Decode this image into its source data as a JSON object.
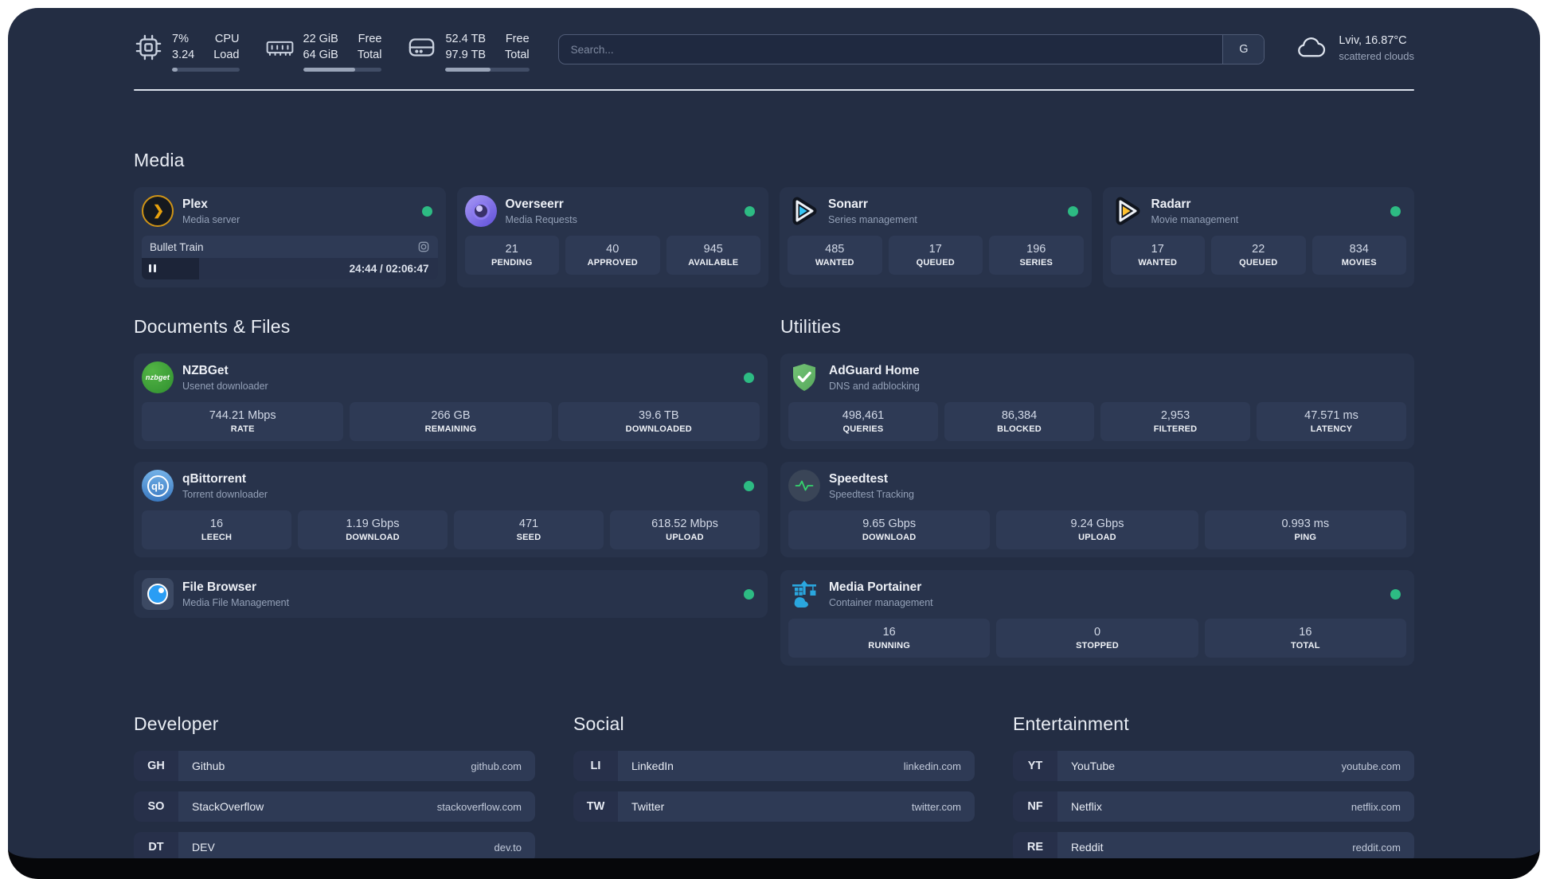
{
  "topbar": {
    "resources": [
      {
        "icon": "cpu-icon",
        "values": [
          "7%",
          "3.24"
        ],
        "labels": [
          "CPU",
          "Load"
        ],
        "progress_pct": 8
      },
      {
        "icon": "ram-icon",
        "values": [
          "22 GiB",
          "64 GiB"
        ],
        "labels": [
          "Free",
          "Total"
        ],
        "progress_pct": 66
      },
      {
        "icon": "disk-icon",
        "values": [
          "52.4 TB",
          "97.9 TB"
        ],
        "labels": [
          "Free",
          "Total"
        ],
        "progress_pct": 54
      }
    ],
    "search": {
      "placeholder": "Search...",
      "provider_initial": "G"
    },
    "weather": {
      "location_temp": "Lviv, 16.87°C",
      "condition": "scattered clouds"
    }
  },
  "sections": {
    "media": {
      "title": "Media",
      "cards": [
        {
          "name": "Plex",
          "subtitle": "Media server",
          "icon": "plex-icon",
          "online": true,
          "player": {
            "title": "Bullet Train",
            "time": "24:44 / 02:06:47",
            "progress_pct": 19.5
          }
        },
        {
          "name": "Overseerr",
          "subtitle": "Media Requests",
          "icon": "overseerr-icon",
          "online": true,
          "stats": [
            {
              "value": "21",
              "label": "PENDING"
            },
            {
              "value": "40",
              "label": "APPROVED"
            },
            {
              "value": "945",
              "label": "AVAILABLE"
            }
          ]
        },
        {
          "name": "Sonarr",
          "subtitle": "Series management",
          "icon": "sonarr-icon",
          "icon_color": "#35c5f4",
          "online": true,
          "stats": [
            {
              "value": "485",
              "label": "WANTED"
            },
            {
              "value": "17",
              "label": "QUEUED"
            },
            {
              "value": "196",
              "label": "SERIES"
            }
          ]
        },
        {
          "name": "Radarr",
          "subtitle": "Movie management",
          "icon": "radarr-icon",
          "icon_color": "#ffc230",
          "online": true,
          "stats": [
            {
              "value": "17",
              "label": "WANTED"
            },
            {
              "value": "22",
              "label": "QUEUED"
            },
            {
              "value": "834",
              "label": "MOVIES"
            }
          ]
        }
      ]
    },
    "documents": {
      "title": "Documents & Files",
      "cards": [
        {
          "name": "NZBGet",
          "subtitle": "Usenet downloader",
          "icon": "nzbget-icon",
          "online": true,
          "stats": [
            {
              "value": "744.21 Mbps",
              "label": "RATE"
            },
            {
              "value": "266 GB",
              "label": "REMAINING"
            },
            {
              "value": "39.6 TB",
              "label": "DOWNLOADED"
            }
          ]
        },
        {
          "name": "qBittorrent",
          "subtitle": "Torrent downloader",
          "icon": "qbittorrent-icon",
          "online": true,
          "stats": [
            {
              "value": "16",
              "label": "LEECH"
            },
            {
              "value": "1.19 Gbps",
              "label": "DOWNLOAD"
            },
            {
              "value": "471",
              "label": "SEED"
            },
            {
              "value": "618.52 Mbps",
              "label": "UPLOAD"
            }
          ]
        },
        {
          "name": "File Browser",
          "subtitle": "Media File Management",
          "icon": "filebrowser-icon",
          "online": true,
          "stats": []
        }
      ]
    },
    "utilities": {
      "title": "Utilities",
      "cards": [
        {
          "name": "AdGuard Home",
          "subtitle": "DNS and adblocking",
          "icon": "adguard-icon",
          "online": false,
          "stats": [
            {
              "value": "498,461",
              "label": "QUERIES"
            },
            {
              "value": "86,384",
              "label": "BLOCKED"
            },
            {
              "value": "2,953",
              "label": "FILTERED"
            },
            {
              "value": "47.571 ms",
              "label": "LATENCY"
            }
          ]
        },
        {
          "name": "Speedtest",
          "subtitle": "Speedtest Tracking",
          "icon": "speedtest-icon",
          "online": false,
          "stats": [
            {
              "value": "9.65 Gbps",
              "label": "DOWNLOAD"
            },
            {
              "value": "9.24 Gbps",
              "label": "UPLOAD"
            },
            {
              "value": "0.993 ms",
              "label": "PING"
            }
          ]
        },
        {
          "name": "Media Portainer",
          "subtitle": "Container management",
          "icon": "portainer-icon",
          "online": true,
          "stats": [
            {
              "value": "16",
              "label": "RUNNING"
            },
            {
              "value": "0",
              "label": "STOPPED"
            },
            {
              "value": "16",
              "label": "TOTAL"
            }
          ]
        }
      ]
    }
  },
  "bookmarks": [
    {
      "title": "Developer",
      "items": [
        {
          "abbr": "GH",
          "name": "Github",
          "url": "github.com"
        },
        {
          "abbr": "SO",
          "name": "StackOverflow",
          "url": "stackoverflow.com"
        },
        {
          "abbr": "DT",
          "name": "DEV",
          "url": "dev.to"
        }
      ]
    },
    {
      "title": "Social",
      "items": [
        {
          "abbr": "LI",
          "name": "LinkedIn",
          "url": "linkedin.com"
        },
        {
          "abbr": "TW",
          "name": "Twitter",
          "url": "twitter.com"
        }
      ]
    },
    {
      "title": "Entertainment",
      "items": [
        {
          "abbr": "YT",
          "name": "YouTube",
          "url": "youtube.com"
        },
        {
          "abbr": "NF",
          "name": "Netflix",
          "url": "netflix.com"
        },
        {
          "abbr": "RE",
          "name": "Reddit",
          "url": "reddit.com"
        }
      ]
    }
  ],
  "brand": {
    "nzbget_logo_text": "nzbget",
    "qbittorrent_logo_text": "qb",
    "status_online_color": "#2dbb83",
    "sonarr_accent": "#35c5f4",
    "radarr_accent": "#ffc230",
    "page_background": "#232d43"
  }
}
